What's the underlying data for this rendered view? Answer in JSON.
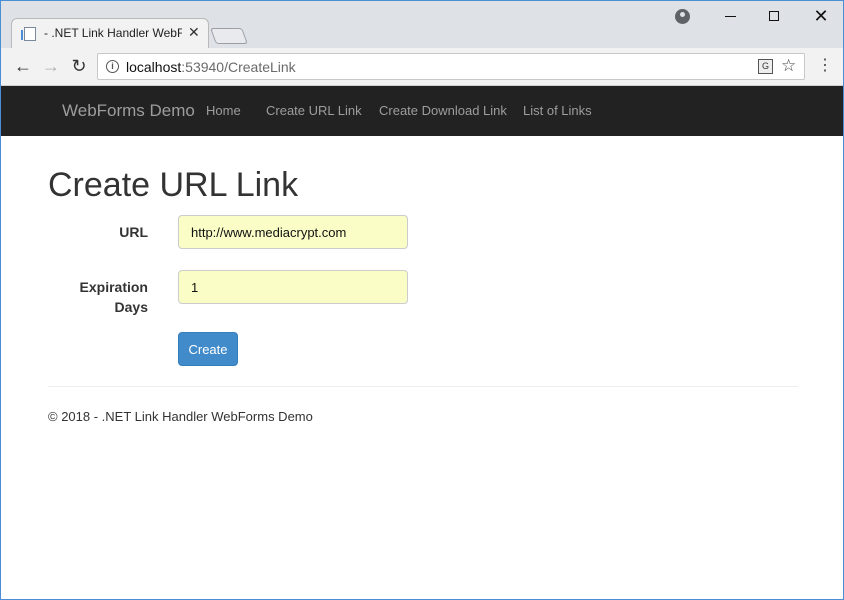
{
  "browser": {
    "tab_title": "- .NET Link Handler WebF",
    "url_host": "localhost",
    "url_rest": ":53940/CreateLink"
  },
  "icons": {
    "back": "arrow-left-icon",
    "forward": "arrow-right-icon",
    "reload": "reload-icon",
    "info": "info-icon",
    "translate": "translate-icon",
    "bookmark": "star-icon",
    "menu": "kebab-menu-icon",
    "profile": "profile-icon"
  },
  "navbar": {
    "brand": "WebForms Demo",
    "links": [
      "Home",
      "Create URL Link",
      "Create Download Link",
      "List of Links"
    ]
  },
  "form": {
    "title": "Create URL Link",
    "url_label": "URL",
    "url_value": "http://www.mediacrypt.com",
    "exp_label": "Expiration Days",
    "exp_value": "1",
    "submit_label": "Create"
  },
  "footer": {
    "text": "© 2018 - .NET Link Handler WebForms Demo"
  },
  "colors": {
    "navbar_bg": "#222222",
    "input_bg": "#fafdc6",
    "button_bg": "#428bca"
  }
}
